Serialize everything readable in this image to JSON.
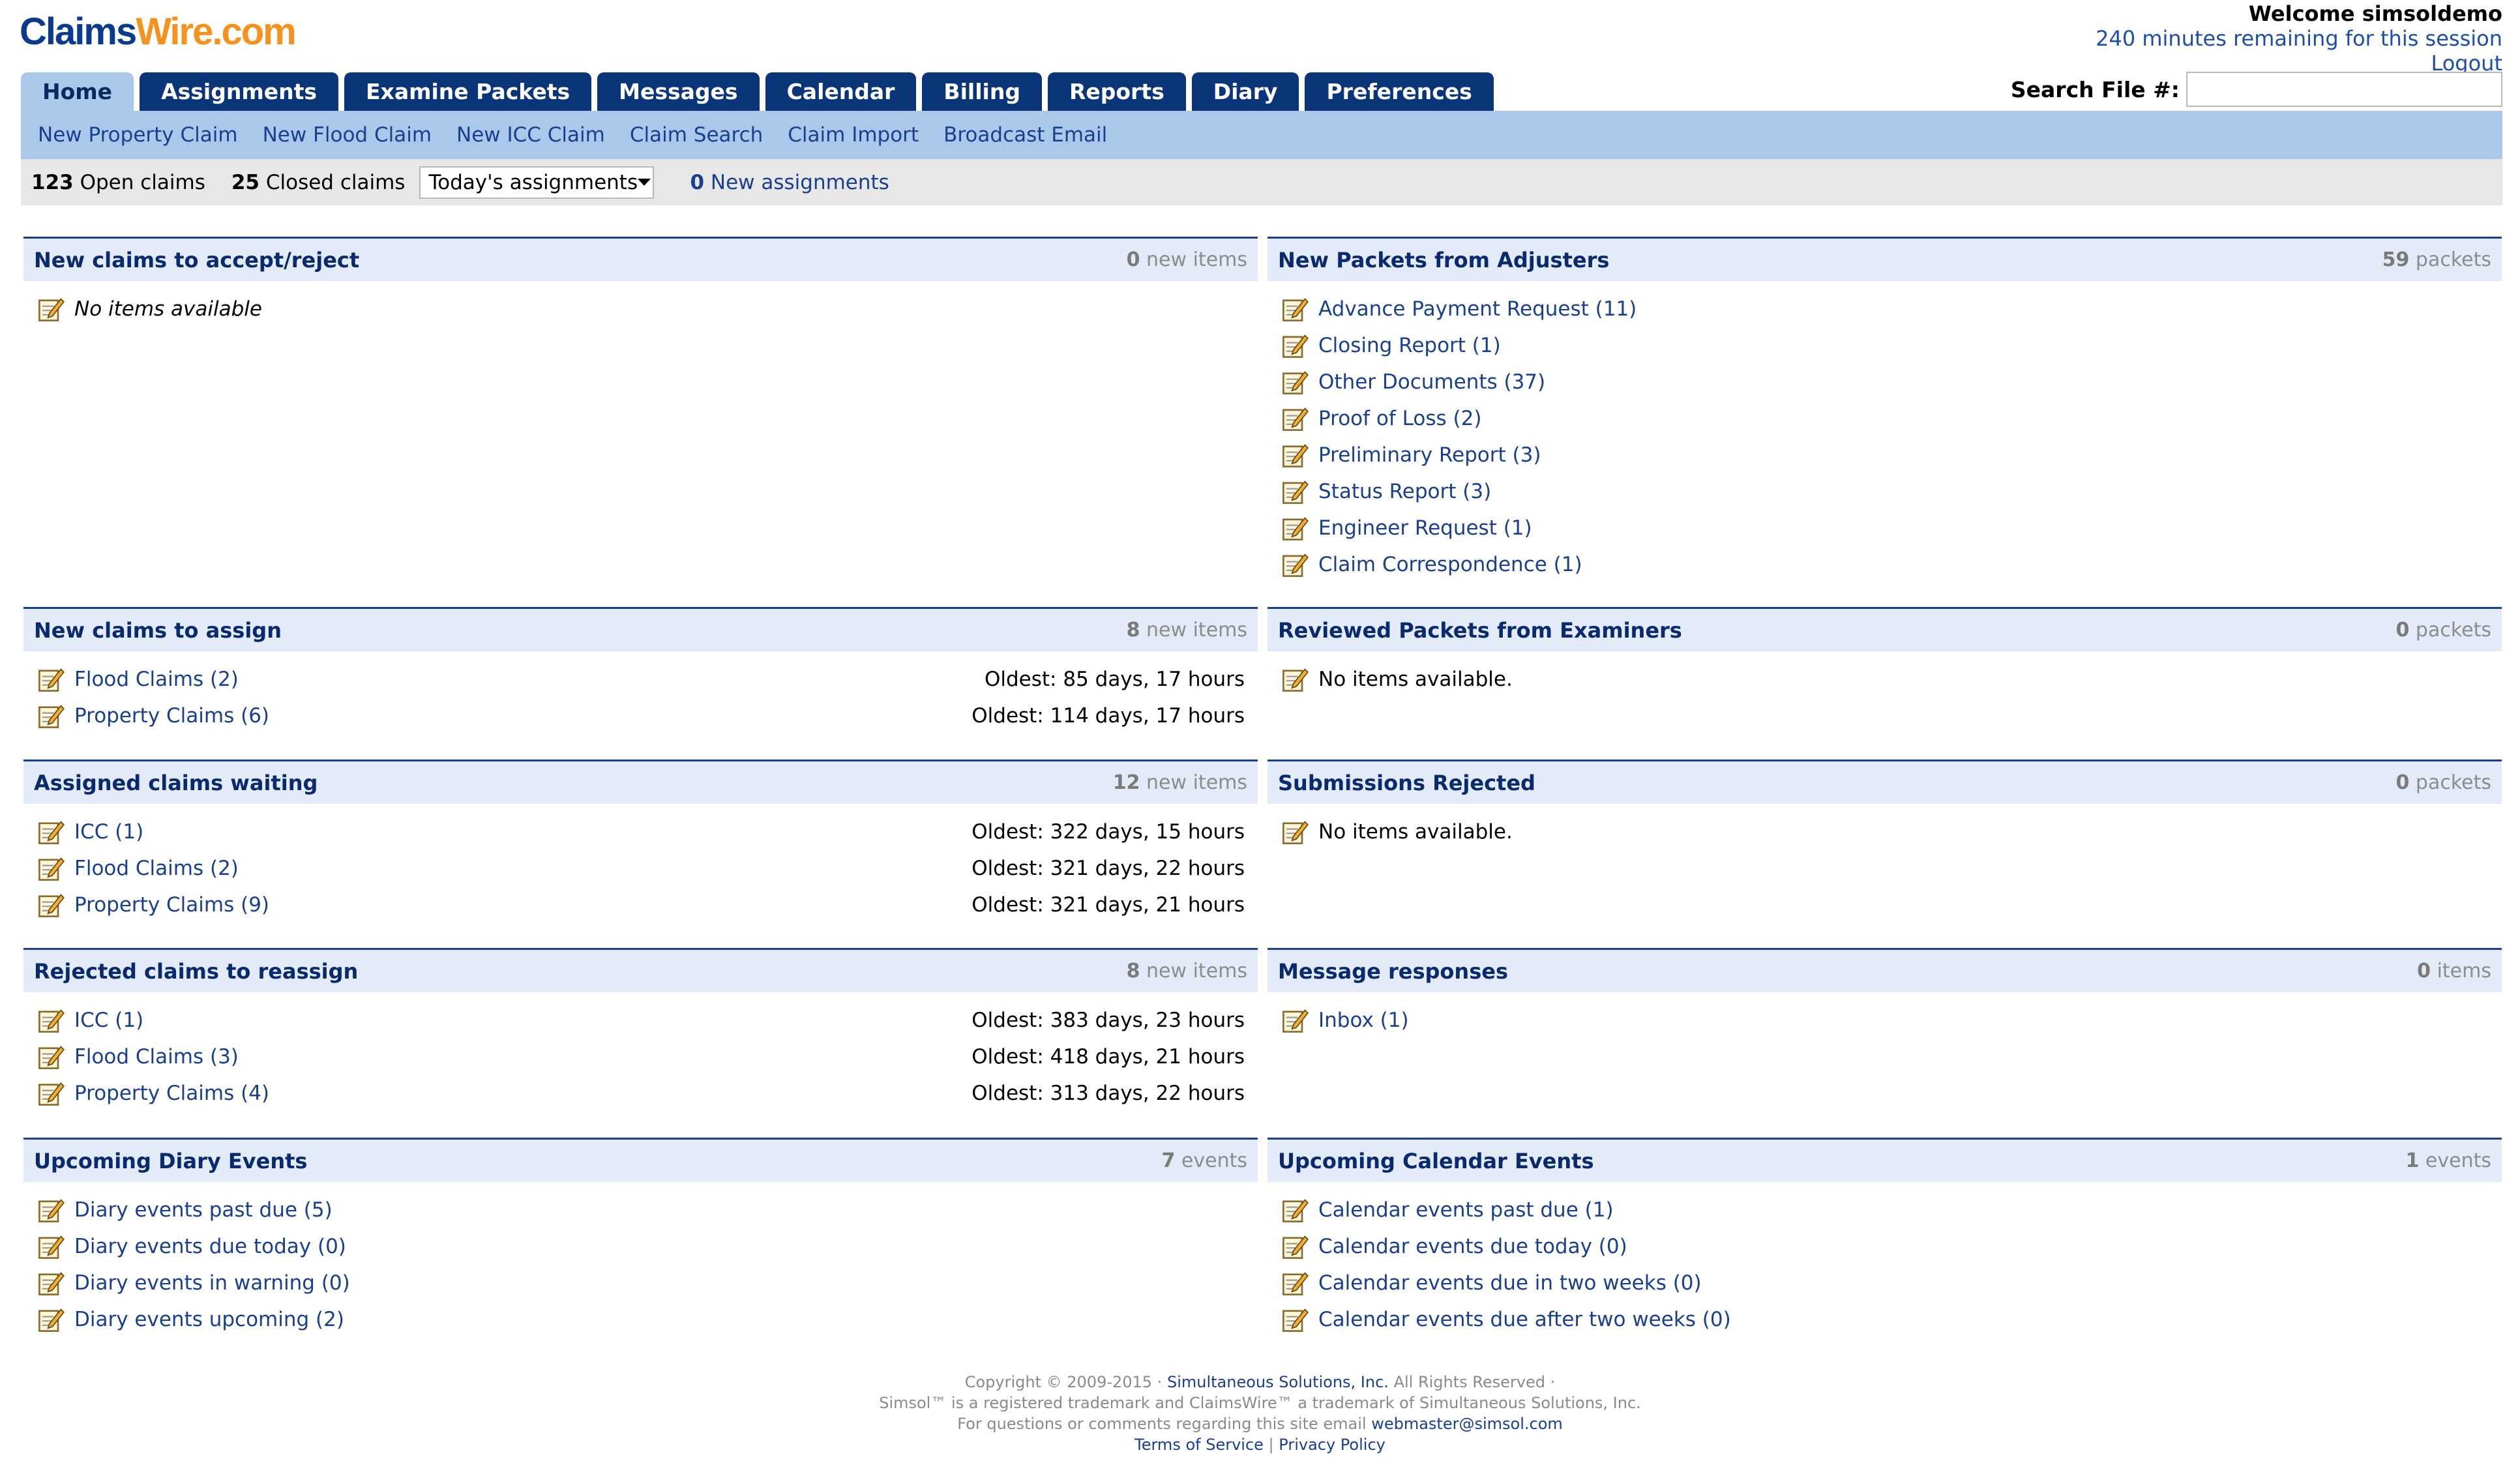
{
  "header": {
    "logo_part1": "Claims",
    "logo_part2": "Wire.com",
    "welcome": "Welcome simsoldemo",
    "remaining": "240 minutes remaining for this session",
    "logout": "Logout",
    "search_label": "Search File #:"
  },
  "tabs": [
    "Home",
    "Assignments",
    "Examine Packets",
    "Messages",
    "Calendar",
    "Billing",
    "Reports",
    "Diary",
    "Preferences"
  ],
  "active_tab": "Home",
  "subnav": [
    "New Property Claim",
    "New Flood Claim",
    "New ICC Claim",
    "Claim Search",
    "Claim Import",
    "Broadcast Email"
  ],
  "status": {
    "open_count": "123",
    "open_label": "Open claims",
    "closed_count": "25",
    "closed_label": "Closed claims",
    "select_value": "Today's assignments",
    "new_count": "0",
    "new_label": "New assignments"
  },
  "panels": {
    "new_claims_accept": {
      "title": "New claims to accept/reject",
      "count": "0",
      "count_label": "new items",
      "empty": "No items available"
    },
    "new_packets": {
      "title": "New Packets from Adjusters",
      "count": "59",
      "count_label": "packets",
      "items": [
        "Advance Payment Request (11)",
        "Closing Report (1)",
        "Other Documents (37)",
        "Proof of Loss (2)",
        "Preliminary Report (3)",
        "Status Report (3)",
        "Engineer Request (1)",
        "Claim Correspondence (1)"
      ]
    },
    "new_claims_assign": {
      "title": "New claims to assign",
      "count": "8",
      "count_label": "new items",
      "items": [
        {
          "label": "Flood Claims (2)",
          "oldest": "Oldest: 85 days, 17 hours"
        },
        {
          "label": "Property Claims (6)",
          "oldest": "Oldest: 114 days, 17 hours"
        }
      ]
    },
    "reviewed_packets": {
      "title": "Reviewed Packets from Examiners",
      "count": "0",
      "count_label": "packets",
      "empty": "No items available."
    },
    "assigned_waiting": {
      "title": "Assigned claims waiting",
      "count": "12",
      "count_label": "new items",
      "items": [
        {
          "label": "ICC (1)",
          "oldest": "Oldest: 322 days, 15 hours"
        },
        {
          "label": "Flood Claims (2)",
          "oldest": "Oldest: 321 days, 22 hours"
        },
        {
          "label": "Property Claims (9)",
          "oldest": "Oldest: 321 days, 21 hours"
        }
      ]
    },
    "submissions_rejected": {
      "title": "Submissions Rejected",
      "count": "0",
      "count_label": "packets",
      "empty": "No items available."
    },
    "rejected_reassign": {
      "title": "Rejected claims to reassign",
      "count": "8",
      "count_label": "new items",
      "items": [
        {
          "label": "ICC (1)",
          "oldest": "Oldest: 383 days, 23 hours"
        },
        {
          "label": "Flood Claims (3)",
          "oldest": "Oldest: 418 days, 21 hours"
        },
        {
          "label": "Property Claims (4)",
          "oldest": "Oldest: 313 days, 22 hours"
        }
      ]
    },
    "message_responses": {
      "title": "Message responses",
      "count": "0",
      "count_label": "items",
      "items": [
        "Inbox (1)"
      ]
    },
    "diary_events": {
      "title": "Upcoming Diary Events",
      "count": "7",
      "count_label": "events",
      "items": [
        "Diary events past due (5)",
        "Diary events due today (0)",
        "Diary events in warning (0)",
        "Diary events upcoming (2)"
      ]
    },
    "calendar_events": {
      "title": "Upcoming Calendar Events",
      "count": "1",
      "count_label": "events",
      "items": [
        "Calendar events past due (1)",
        "Calendar events due today (0)",
        "Calendar events due in two weeks (0)",
        "Calendar events due after two weeks (0)"
      ]
    }
  },
  "footer": {
    "copyright_pre": "Copyright © 2009-2015 ·",
    "company": "Simultaneous Solutions, Inc.",
    "rights": "All Rights Reserved ·",
    "trademark": "Simsol™ is a registered trademark and ClaimsWire™ a trademark of Simultaneous Solutions, Inc.",
    "questions": "For questions or comments regarding this site email",
    "email": "webmaster@simsol.com",
    "terms": "Terms of Service",
    "sep": "|",
    "privacy": "Privacy Policy"
  },
  "icons": {
    "item": "edit-note-icon",
    "dropdown": "caret-down-icon"
  },
  "colors": {
    "tab_bg": "#0a3578",
    "subnav_bg": "#a9c8ea",
    "link": "#1a3f8f",
    "logo_blue": "#0a3a8c",
    "logo_orange": "#f5921e"
  }
}
